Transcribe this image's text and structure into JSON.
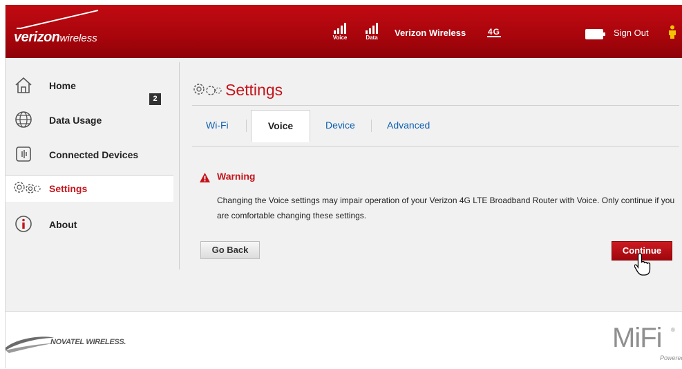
{
  "header": {
    "logo": {
      "brand": "verizon",
      "suffix": "wireless"
    },
    "signals": [
      {
        "label": "Voice",
        "bars": 4
      },
      {
        "label": "Data",
        "bars": 4
      }
    ],
    "carrier": "Verizon Wireless",
    "network": "4G",
    "battery_icon": "battery-icon",
    "sign_out": "Sign Out"
  },
  "sidebar": {
    "items": [
      {
        "label": "Home",
        "icon": "home-icon"
      },
      {
        "label": "Data Usage",
        "icon": "globe-icon"
      },
      {
        "label": "Connected Devices",
        "icon": "devices-icon",
        "badge": "2"
      },
      {
        "label": "Settings",
        "icon": "gears-icon",
        "active": true
      },
      {
        "label": "About",
        "icon": "info-icon"
      }
    ]
  },
  "main": {
    "title": "Settings",
    "tabs": [
      {
        "label": "Wi-Fi"
      },
      {
        "label": "Voice",
        "active": true
      },
      {
        "label": "Device"
      },
      {
        "label": "Advanced"
      }
    ],
    "warning": {
      "title": "Warning",
      "message": "Changing the Voice settings may impair operation of your Verizon 4G LTE Broadband Router with Voice. Only continue if you are comfortable changing these settings."
    },
    "buttons": {
      "back": "Go Back",
      "continue": "Continue"
    }
  },
  "footer": {
    "brand": "NOVATEL WIRELESS.",
    "product": "MiFi",
    "registered": "®",
    "powered": "Powered"
  },
  "colors": {
    "brand_red": "#c4141b",
    "header_red": "#a8050c",
    "link_blue": "#0d5fb0"
  }
}
